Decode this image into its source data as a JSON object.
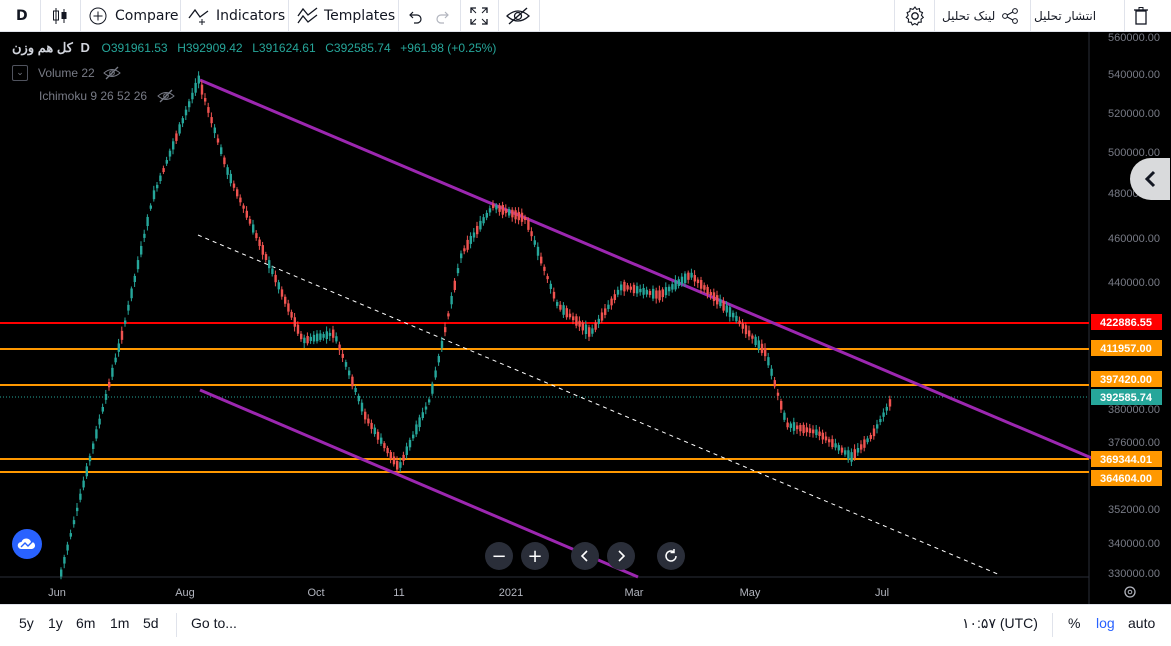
{
  "toolbar": {
    "interval": "D",
    "compare_label": "Compare",
    "indicators_label": "Indicators",
    "templates_label": "Templates",
    "share_analysis_label": "لینک تحلیل",
    "publish_analysis_label": "انتشار تحلیل"
  },
  "legend": {
    "symbol": "کل هم وزن",
    "interval": "D",
    "open": "O391961.53",
    "high": "H392909.42",
    "low": "L391624.61",
    "close": "C392585.74",
    "change": "+961.98 (+0.25%)",
    "volume_label": "Volume 22",
    "ichimoku_label": "Ichimoku 9 26 52 26"
  },
  "price_axis": {
    "ticks": [
      "560000.00",
      "540000.00",
      "520000.00",
      "500000.00",
      "480000.00",
      "460000.00",
      "440000.00",
      "380000.00",
      "376000.00",
      "352000.00",
      "340000.00",
      "330000.00"
    ],
    "levels": [
      {
        "label": "422886.55",
        "color": "#ff0000"
      },
      {
        "label": "411957.00",
        "color": "#ff9800"
      },
      {
        "label": "397420.00",
        "color": "#ff9800"
      },
      {
        "label": "392585.74",
        "color": "#26a69a"
      },
      {
        "label": "369344.01",
        "color": "#ff9800"
      },
      {
        "label": "364604.00",
        "color": "#ff9800"
      }
    ]
  },
  "time_axis": {
    "labels": [
      "Jun",
      "Aug",
      "Oct",
      "11",
      "2021",
      "Mar",
      "May",
      "Jul"
    ]
  },
  "bottom": {
    "ranges": [
      "5y",
      "1y",
      "6m",
      "1m",
      "5d"
    ],
    "goto_label": "Go to...",
    "time_label": "۱۰:۵۷ (UTC)",
    "percent_label": "%",
    "log_label": "log",
    "auto_label": "auto"
  },
  "colors": {
    "up": "#26a69a",
    "down": "#ef5350",
    "channel": "#9c27b0",
    "resistance": "#ff0000",
    "support": "#ff9800",
    "accent": "#2962ff"
  },
  "chart_data": {
    "type": "candlestick",
    "price_series": [
      [
        "2020-06-01",
        330000
      ],
      [
        "2020-06-15",
        370000
      ],
      [
        "2020-07-01",
        420000
      ],
      [
        "2020-07-15",
        478000
      ],
      [
        "2020-08-06",
        537000
      ],
      [
        "2020-08-20",
        490000
      ],
      [
        "2020-09-10",
        445000
      ],
      [
        "2020-09-25",
        415000
      ],
      [
        "2020-10-10",
        418000
      ],
      [
        "2020-10-25",
        385000
      ],
      [
        "2020-11-10",
        366000
      ],
      [
        "2020-11-25",
        392000
      ],
      [
        "2020-12-10",
        452000
      ],
      [
        "2020-12-25",
        474000
      ],
      [
        "2021-01-10",
        468000
      ],
      [
        "2021-01-25",
        430000
      ],
      [
        "2021-02-10",
        418000
      ],
      [
        "2021-02-25",
        438000
      ],
      [
        "2021-03-15",
        434000
      ],
      [
        "2021-03-30",
        443000
      ],
      [
        "2021-04-20",
        425000
      ],
      [
        "2021-05-05",
        410000
      ],
      [
        "2021-05-15",
        382000
      ],
      [
        "2021-05-30",
        379000
      ],
      [
        "2021-06-15",
        370000
      ],
      [
        "2021-06-25",
        378000
      ],
      [
        "2021-07-05",
        392585.74
      ]
    ],
    "horizontal_levels": [
      422886.55,
      411957.0,
      397420.0,
      369344.01,
      364604.0
    ],
    "last_price": 392585.74
  }
}
